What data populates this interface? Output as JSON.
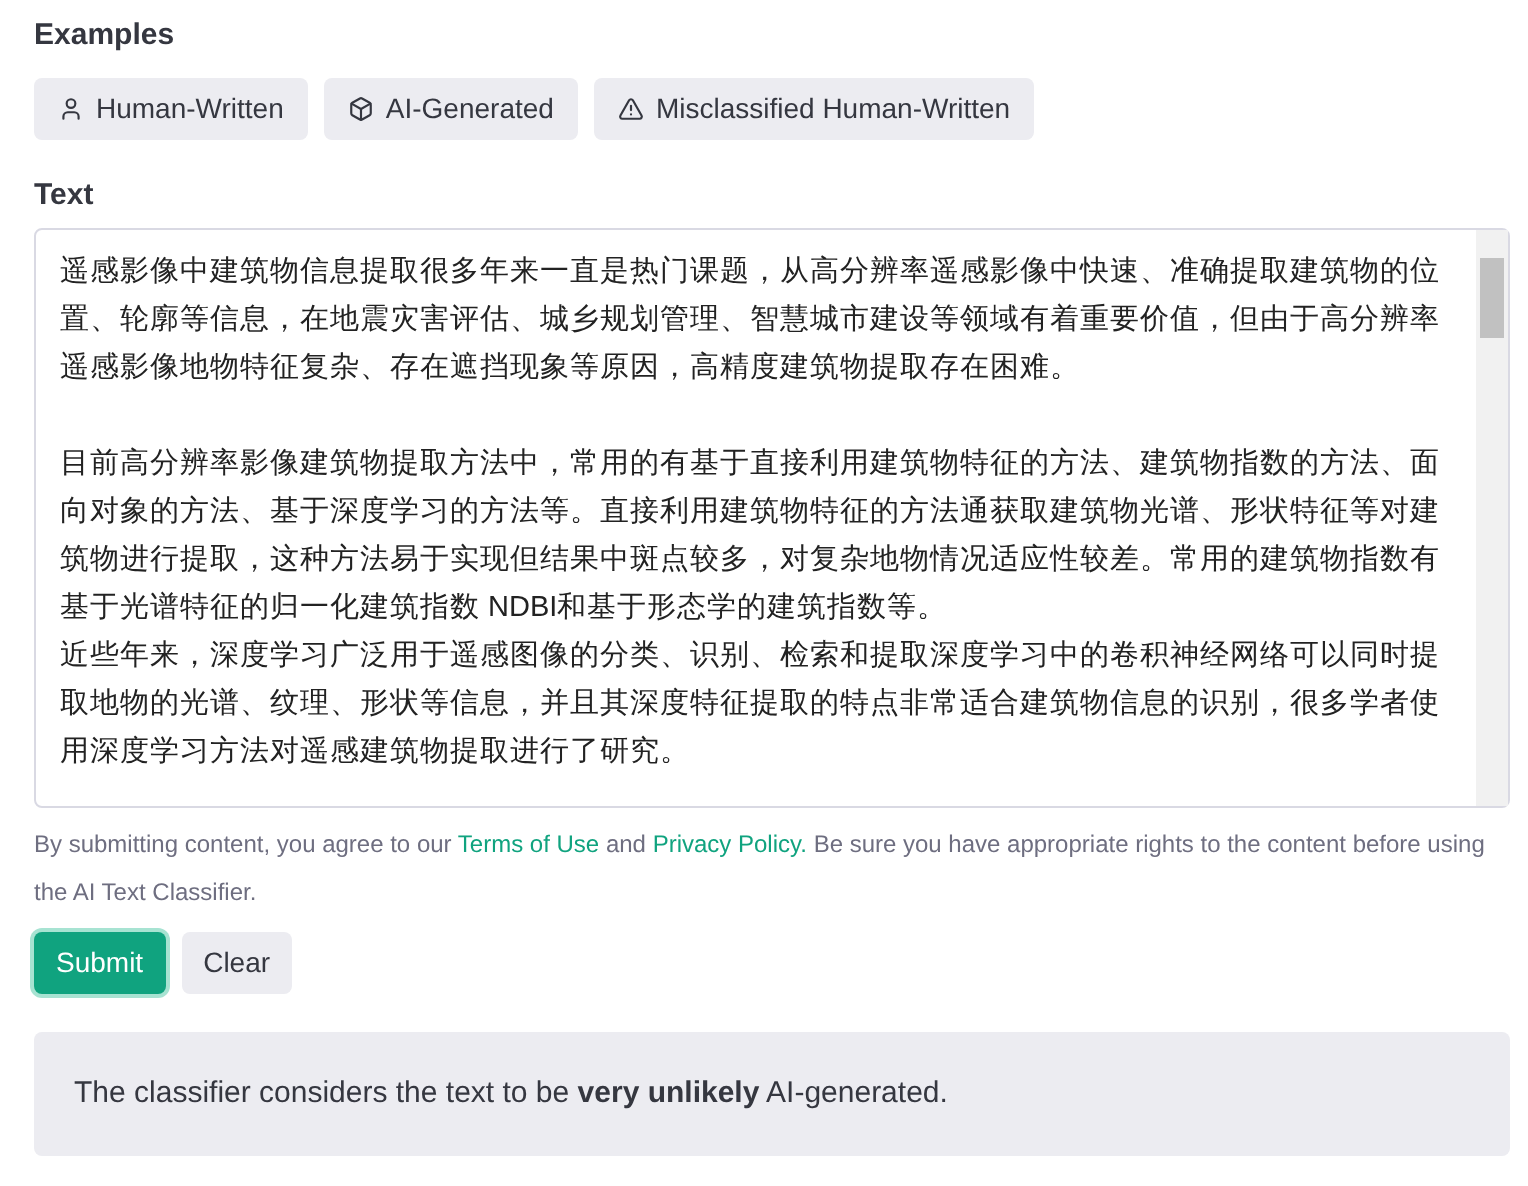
{
  "examples": {
    "title": "Examples",
    "items": [
      {
        "label": "Human-Written",
        "kind": "person"
      },
      {
        "label": "AI-Generated",
        "kind": "cube"
      },
      {
        "label": "Misclassified Human-Written",
        "kind": "warning"
      }
    ]
  },
  "text": {
    "label": "Text",
    "blocks": [
      {
        "paragraphs": [
          "遥感影像中建筑物信息提取很多年来一直是热门课题，从高分辨率遥感影像中快速、准确提取建筑物的位置、轮廓等信息，在地震灾害评估、城乡规划管理、智慧城市建设等领域有着重要价值，但由于高分辨率遥感影像地物特征复杂、存在遮挡现象等原因，高精度建筑物提取存在困难。"
        ]
      },
      {
        "paragraphs": [
          "目前高分辨率影像建筑物提取方法中，常用的有基于直接利用建筑物特征的方法、建筑物指数的方法、面向对象的方法、基于深度学习的方法等。直接利用建筑物特征的方法通获取建筑物光谱、形状特征等对建筑物进行提取，这种方法易于实现但结果中斑点较多，对复杂地物情况适应性较差。常用的建筑物指数有基于光谱特征的归一化建筑指数 NDBI和基于形态学的建筑指数等。",
          "近些年来，深度学习广泛用于遥感图像的分类、识别、检索和提取深度学习中的卷积神经网络可以同时提取地物的光谱、纹理、形状等信息，并且其深度特征提取的特点非常适合建筑物信息的识别，很多学者使用深度学习方法对遥感建筑物提取进行了研究。"
        ]
      }
    ]
  },
  "disclaimer": {
    "before": "By submitting content, you agree to our",
    "link_1": "Terms of Use",
    "middle": "and",
    "link_2": "Privacy Policy.",
    "after": "Be sure you have appropriate rights to the content before using the AI Text Classifier."
  },
  "buttons": [
    {
      "label": "Submit",
      "kind": "primary"
    },
    {
      "label": "Clear",
      "kind": "secondary"
    }
  ],
  "result": "The classifier considers the text to be **very unlikely** AI-generated."
}
